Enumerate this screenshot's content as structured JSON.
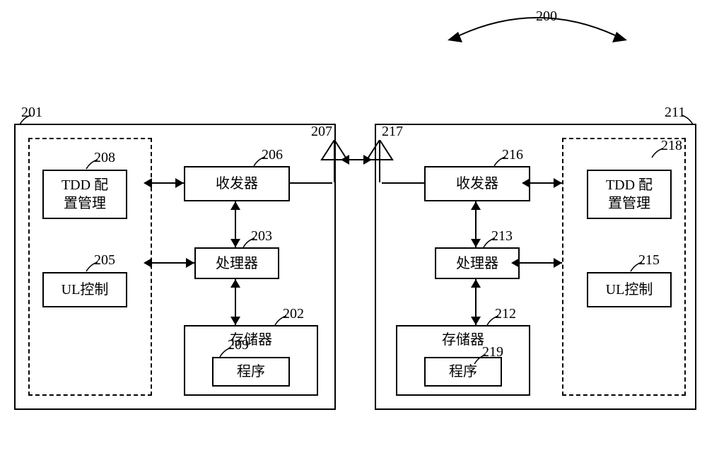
{
  "system_ref": "200",
  "left": {
    "ref": "201",
    "dashed_ref": "",
    "tdd": {
      "ref": "208",
      "label": "TDD 配\n置管理"
    },
    "ul": {
      "ref": "205",
      "label": "UL控制"
    },
    "transceiver": {
      "ref": "206",
      "label": "收发器"
    },
    "processor": {
      "ref": "203",
      "label": "处理器"
    },
    "memory": {
      "ref": "202",
      "label": "存储器"
    },
    "program": {
      "ref": "209",
      "label": "程序"
    },
    "antenna": {
      "ref": "207"
    }
  },
  "right": {
    "ref": "211",
    "dashed_ref": "218",
    "tdd": {
      "ref": "218",
      "label": "TDD 配\n置管理"
    },
    "ul": {
      "ref": "215",
      "label": "UL控制"
    },
    "transceiver": {
      "ref": "216",
      "label": "收发器"
    },
    "processor": {
      "ref": "213",
      "label": "处理器"
    },
    "memory": {
      "ref": "212",
      "label": "存储器"
    },
    "program": {
      "ref": "219",
      "label": "程序"
    },
    "antenna": {
      "ref": "217"
    }
  }
}
